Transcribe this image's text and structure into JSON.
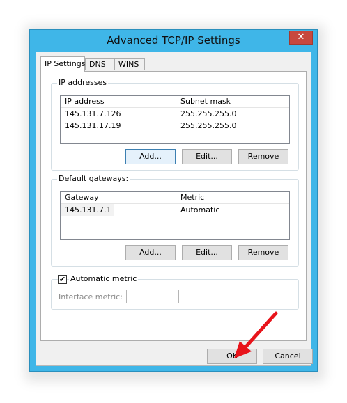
{
  "window": {
    "title": "Advanced TCP/IP Settings",
    "close_glyph": "✕"
  },
  "tabs": [
    {
      "label": "IP Settings"
    },
    {
      "label": "DNS"
    },
    {
      "label": "WINS"
    }
  ],
  "ip_addresses": {
    "group_label": "IP addresses",
    "columns": [
      "IP address",
      "Subnet mask"
    ],
    "rows": [
      {
        "ip": "145.131.7.126",
        "mask": "255.255.255.0"
      },
      {
        "ip": "145.131.17.19",
        "mask": "255.255.255.0"
      }
    ],
    "buttons": {
      "add": "Add...",
      "edit": "Edit...",
      "remove": "Remove"
    }
  },
  "gateways": {
    "group_label": "Default gateways:",
    "columns": [
      "Gateway",
      "Metric"
    ],
    "rows": [
      {
        "gateway": "145.131.7.1",
        "metric": "Automatic"
      }
    ],
    "buttons": {
      "add": "Add...",
      "edit": "Edit...",
      "remove": "Remove"
    }
  },
  "metric": {
    "checkbox_label": "Automatic metric",
    "checked_glyph": "✔",
    "interface_metric_label": "Interface metric:",
    "interface_metric_value": ""
  },
  "footer": {
    "ok": "OK",
    "cancel": "Cancel"
  },
  "colors": {
    "title_bar": "#3fb6e8",
    "close_button": "#c7483e",
    "arrow": "#e8141b"
  }
}
